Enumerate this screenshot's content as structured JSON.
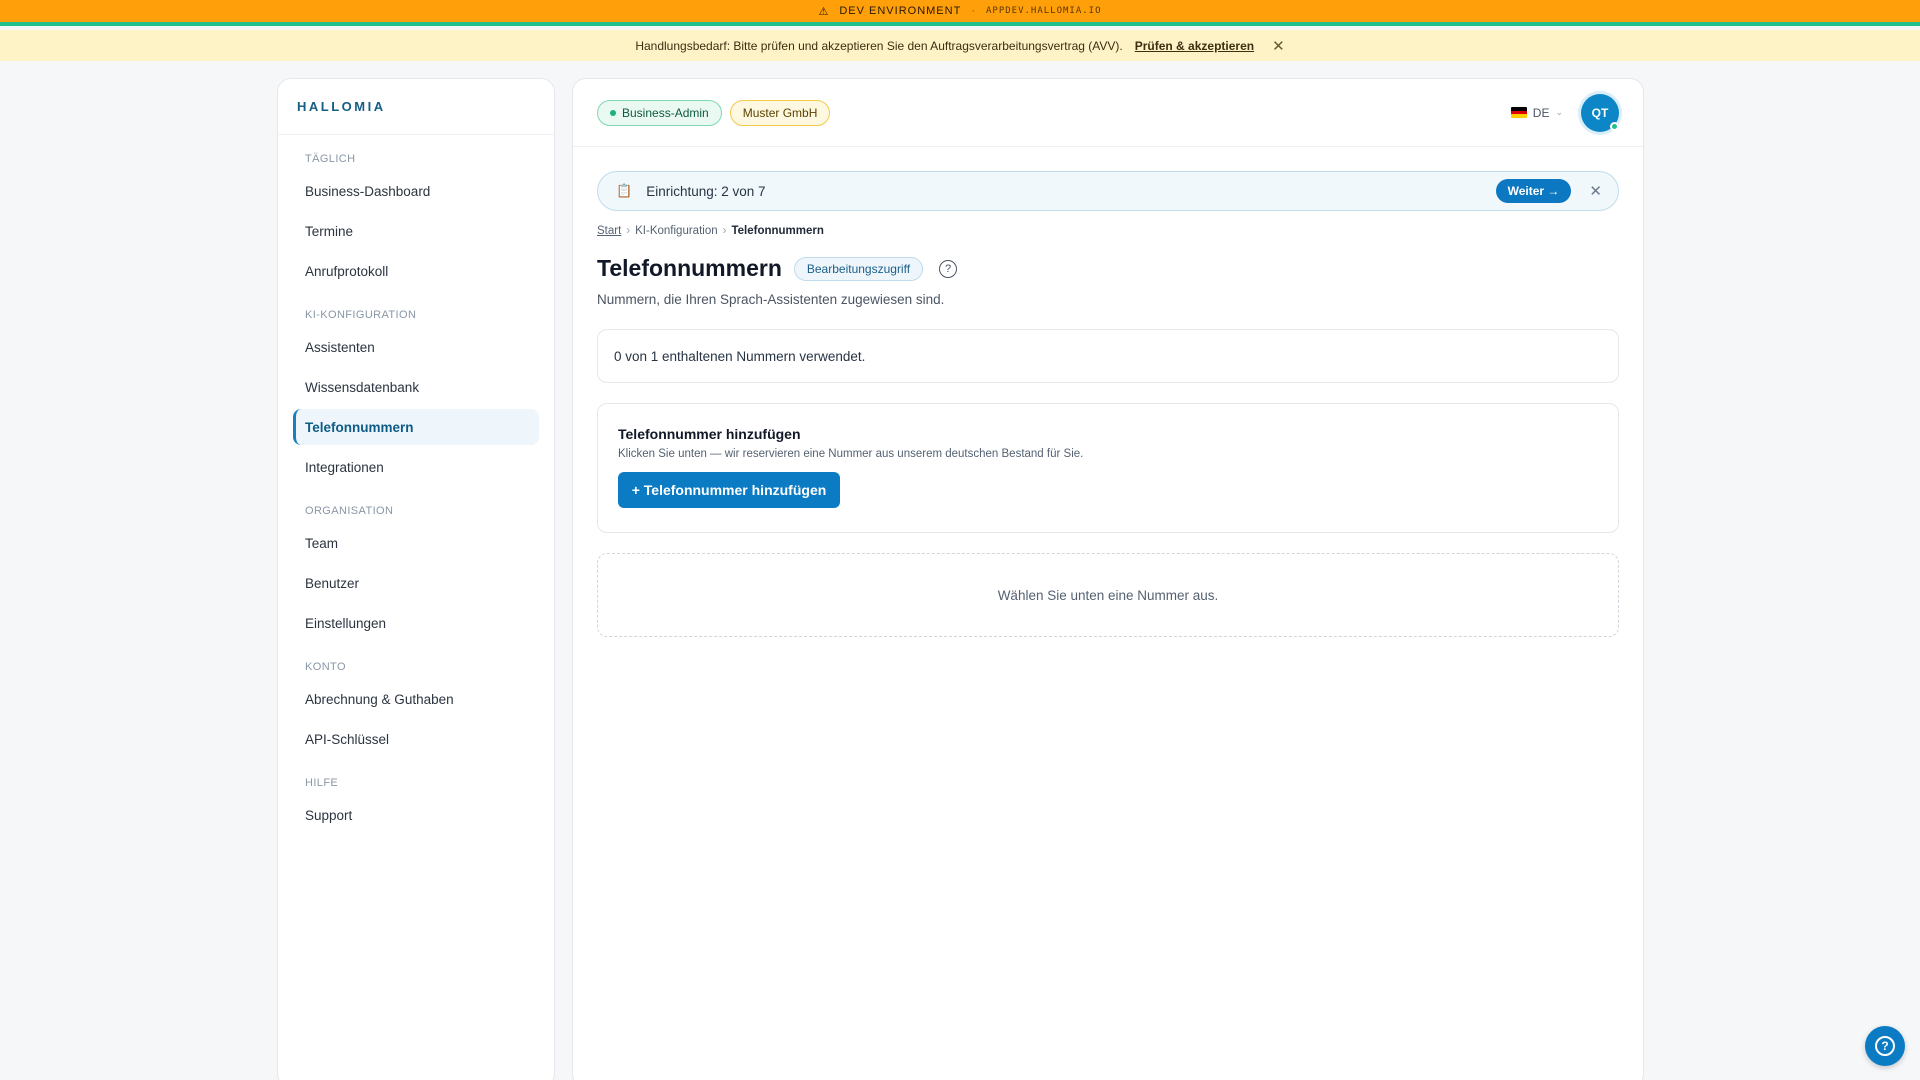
{
  "dev_banner": {
    "icon": "warning-icon",
    "label": "DEV ENVIRONMENT",
    "separator": "·",
    "url": "APPDEV.HALLOMIA.IO"
  },
  "notice": {
    "text": "Handlungsbedarf: Bitte prüfen und akzeptieren Sie den Auftragsverarbeitungsvertrag (AVV).",
    "link": "Prüfen & akzeptieren",
    "close": "✕"
  },
  "sidebar": {
    "brand": "HALLOMIA",
    "sections": [
      {
        "title": "TÄGLICH",
        "items": [
          "Business-Dashboard",
          "Termine",
          "Anrufprotokoll"
        ]
      },
      {
        "title": "KI-KONFIGURATION",
        "items": [
          "Assistenten",
          "Wissensdatenbank",
          "Telefonnummern",
          "Integrationen"
        ]
      },
      {
        "title": "ORGANISATION",
        "items": [
          "Team",
          "Benutzer",
          "Einstellungen"
        ]
      },
      {
        "title": "KONTO",
        "items": [
          "Abrechnung & Guthaben",
          "API-Schlüssel"
        ]
      },
      {
        "title": "HILFE",
        "items": [
          "Support"
        ]
      }
    ],
    "active_item": "Telefonnummern"
  },
  "header": {
    "role_badge": "Business-Admin",
    "org_badge": "Muster GmbH",
    "language": "DE",
    "avatar_initials": "QT"
  },
  "setup": {
    "text": "Einrichtung: 2 von 7",
    "button": "Weiter →",
    "close": "✕"
  },
  "breadcrumb": {
    "items": [
      "Start",
      "KI-Konfiguration",
      "Telefonnummern"
    ],
    "separator": "›"
  },
  "page": {
    "title": "Telefonnummern",
    "access_badge": "Bearbeitungszugriff",
    "help": "?",
    "subtitle": "Nummern, die Ihren Sprach-Assistenten zugewiesen sind.",
    "usage": "0 von 1 enthaltenen Nummern verwendet.",
    "add_card": {
      "heading": "Telefonnummer hinzufügen",
      "description": "Klicken Sie unten — wir reservieren eine Nummer aus unserem deutschen Bestand für Sie.",
      "button": "+ Telefonnummer hinzufügen"
    },
    "empty_state": "Wählen Sie unten eine Nummer aus."
  },
  "fab": {
    "icon": "help-circle-icon",
    "label": "?"
  },
  "colors": {
    "dev_bar": "#ff9f0a",
    "notice_bg": "#fdf3c7",
    "primary": "#0b7bc4",
    "brand": "#145f83"
  }
}
